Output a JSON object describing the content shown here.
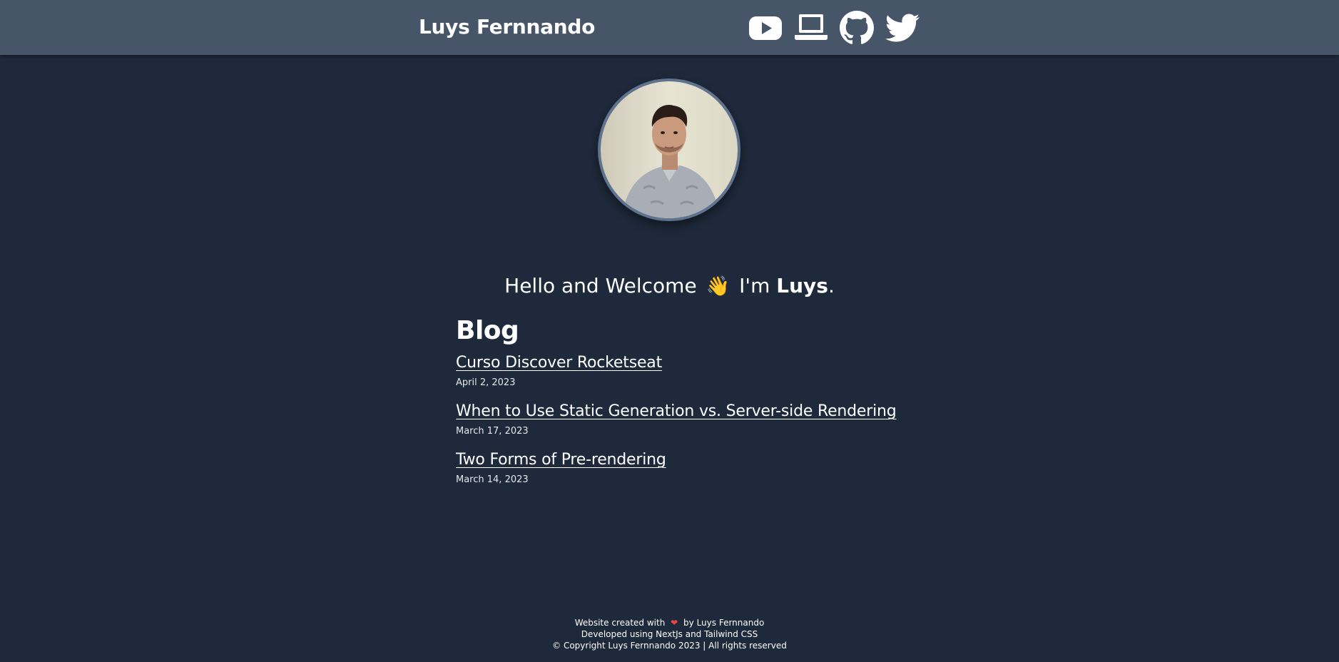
{
  "header": {
    "site_title": "Luys Fernnando",
    "background_color": "#475569",
    "socials": [
      {
        "icon": "youtube-icon"
      },
      {
        "icon": "laptop-icon"
      },
      {
        "icon": "github-icon"
      },
      {
        "icon": "twitter-icon"
      }
    ]
  },
  "hero": {
    "greeting_prefix": "Hello and Welcome",
    "wave_emoji": "👋",
    "greeting_mid": "I'm",
    "name": "Luys",
    "greeting_suffix": "."
  },
  "blog": {
    "heading": "Blog",
    "posts": [
      {
        "title": "Curso Discover Rocketseat",
        "date": "April 2, 2023"
      },
      {
        "title": "When to Use Static Generation vs. Server-side Rendering",
        "date": "March 17, 2023"
      },
      {
        "title": "Two Forms of Pre-rendering",
        "date": "March 14, 2023"
      }
    ]
  },
  "footer": {
    "created_prefix": "Website created with",
    "heart_icon": "heart-icon",
    "created_suffix": "by Luys Fernnando",
    "developed": "Developed using NextJs and Tailwind CSS",
    "copyright": "© Copyright Luys Fernnando 2023 | All rights reserved"
  },
  "colors": {
    "page_background": "#1e293b",
    "heart": "#ef4444"
  }
}
